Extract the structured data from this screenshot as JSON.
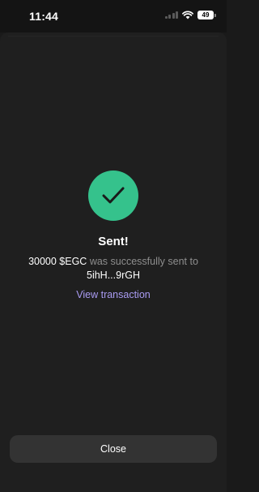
{
  "status_bar": {
    "time": "11:44",
    "battery": "49"
  },
  "result": {
    "icon": "checkmark-icon",
    "title": "Sent!",
    "amount": "30000 $EGC",
    "message_text": "was successfully sent to",
    "address": "5ihH...9rGH",
    "view_link": "View transaction"
  },
  "footer": {
    "close_label": "Close"
  },
  "colors": {
    "background": "#1a1a1a",
    "success": "#35c28c",
    "link": "#a99bf2",
    "button": "#333333",
    "muted_text": "#8e8e8e"
  }
}
